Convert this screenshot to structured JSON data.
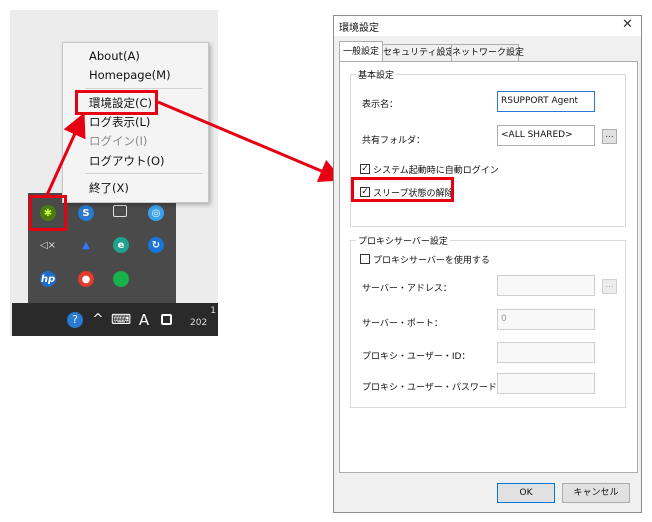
{
  "tray_menu": {
    "items": [
      {
        "label": "About(A)",
        "enabled": true
      },
      {
        "label": "Homepage(M)",
        "enabled": true
      },
      {
        "label": "環境設定(C)",
        "enabled": true
      },
      {
        "label": "ログ表示(L)",
        "enabled": true
      },
      {
        "label": "ログイン(I)",
        "enabled": false
      },
      {
        "label": "ログアウト(O)",
        "enabled": true
      },
      {
        "label": "終了(X)",
        "enabled": true
      }
    ]
  },
  "taskbar": {
    "ime_indicator": "A",
    "date_fragment_top": "1",
    "date_fragment_bottom": "202"
  },
  "dialog": {
    "title": "環境設定",
    "close_glyph": "✕",
    "tabs": [
      "一般設定",
      "セキュリティ設定",
      "ネットワーク設定"
    ],
    "active_tab": 0,
    "basic": {
      "group_label": "基本設定",
      "display_name_label": "表示名：",
      "display_name_value": "RSUPPORT Agent",
      "shared_folder_label": "共有フォルダ：",
      "shared_folder_value": "<ALL SHARED>",
      "browse_glyph": "...",
      "auto_login_label": "システム起動時に自動ログイン",
      "auto_login_checked": true,
      "sleep_release_label": "スリープ状態の解除",
      "sleep_release_checked": true
    },
    "proxy": {
      "group_label": "プロキシサーバー設定",
      "use_proxy_label": "プロキシサーバーを使用する",
      "use_proxy_checked": false,
      "address_label": "サーバー・アドレス：",
      "address_value": "",
      "port_label": "サーバー・ポート：",
      "port_value": "0",
      "proxy_id_label": "プロキシ・ユーザー・ID：",
      "proxy_id_value": "",
      "proxy_password_label": "プロキシ・ユーザー・パスワード：",
      "proxy_password_value": "",
      "browse_glyph": "..."
    },
    "buttons": {
      "ok": "OK",
      "cancel": "キャンセル"
    }
  },
  "colors": {
    "highlight_red": "#e60012",
    "tray_background": "#4a4a4a",
    "taskbar_background": "#2a2a2a"
  }
}
